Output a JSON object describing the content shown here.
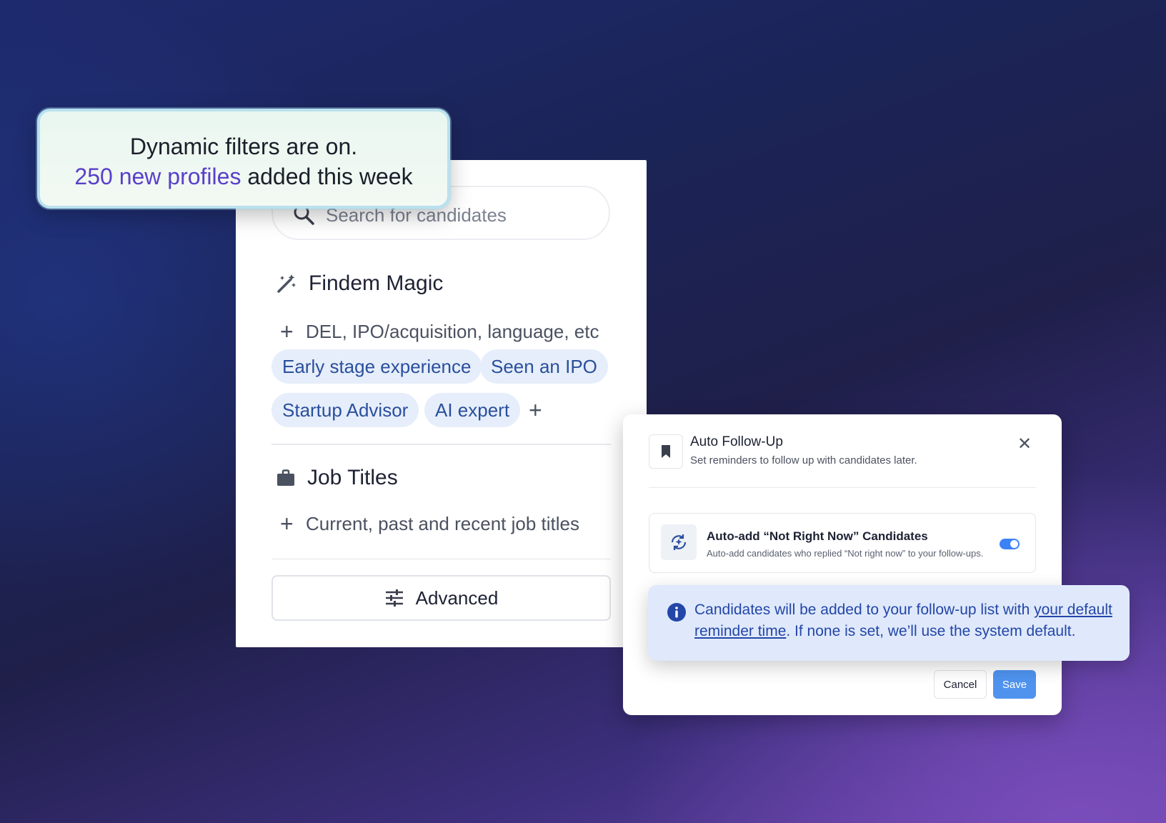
{
  "callout": {
    "line1": "Dynamic filters are on.",
    "highlight": "250 new profiles",
    "rest": " added this week"
  },
  "search": {
    "placeholder": "Search for candidates",
    "icon": "search-icon"
  },
  "magic": {
    "title": "Findem Magic",
    "icon": "magic-wand-icon",
    "add_label": "DEL, IPO/acquisition, language, etc",
    "chips": [
      "Early stage experience",
      "Seen an IPO",
      "Startup Advisor",
      "AI expert"
    ]
  },
  "job_titles": {
    "title": "Job Titles",
    "icon": "briefcase-icon",
    "add_label": "Current, past and recent job titles"
  },
  "advanced": {
    "label": "Advanced",
    "icon": "sliders-icon"
  },
  "dialog": {
    "title": "Auto Follow-Up",
    "subtitle": "Set reminders to follow up with candidates later.",
    "icon": "bookmark-icon",
    "option": {
      "title": "Auto-add “Not Right Now” Candidates",
      "subtitle": "Auto-add candidates who replied “Not right now” to your follow-ups.",
      "icon": "auto-add-icon",
      "enabled": true
    },
    "cancel_label": "Cancel",
    "save_label": "Save"
  },
  "info": {
    "text_before": "Candidates will be added to your follow-up list with ",
    "link_text": "your default reminder time",
    "text_after": ". If none is set, we’ll use the system default.",
    "icon": "info-icon"
  },
  "colors": {
    "accent_purple": "#5840c9",
    "chip_bg": "#e6eefb",
    "chip_text": "#2a4f9c",
    "toggle_on": "#3b82f6",
    "save_button": "#4f93ee",
    "info_text": "#2446a8"
  }
}
